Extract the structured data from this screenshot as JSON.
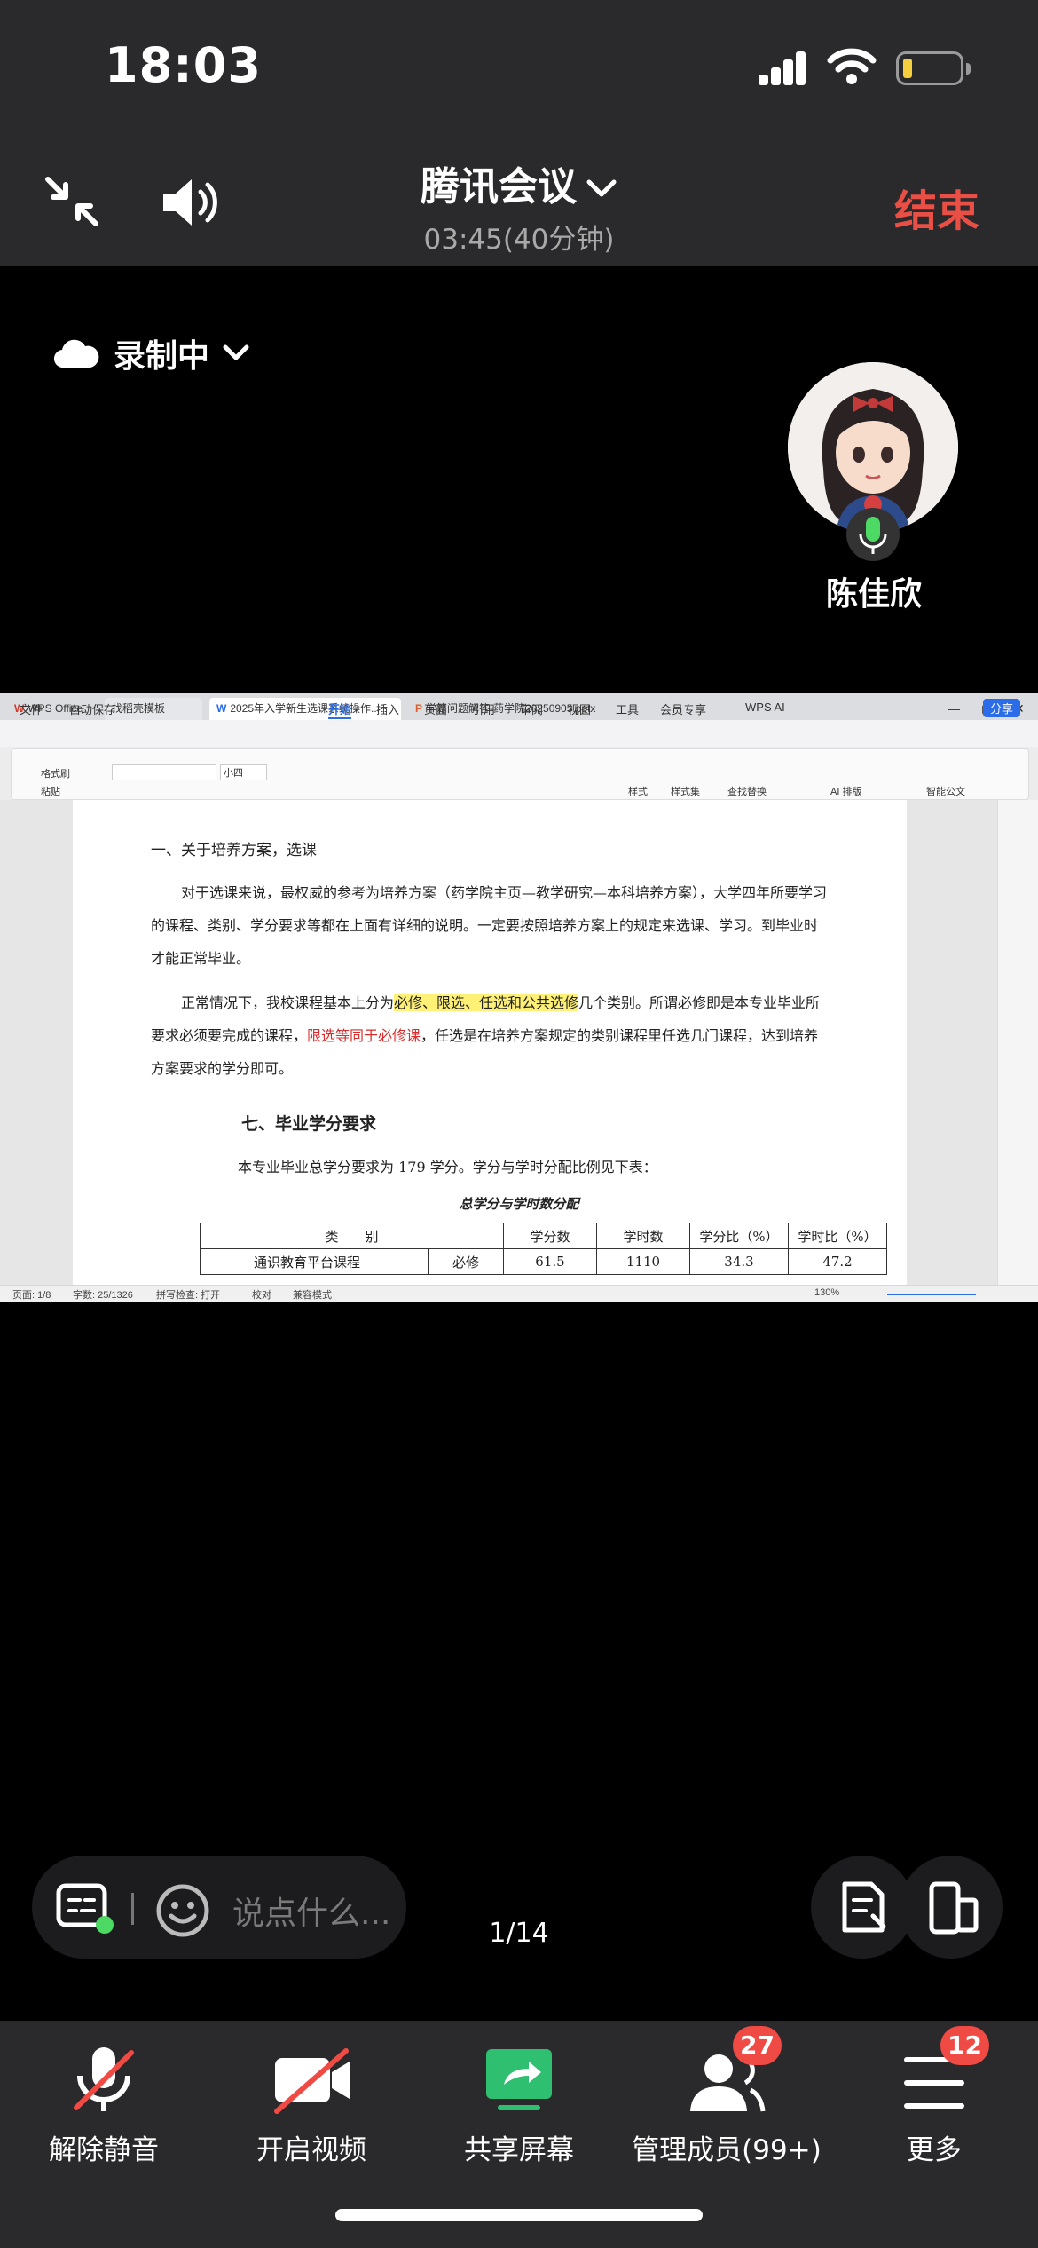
{
  "status_bar": {
    "time": "18:03"
  },
  "meeting": {
    "title": "腾讯会议",
    "timer": "03:45(40分钟)",
    "end_label": "结束"
  },
  "recording": {
    "label": "录制中"
  },
  "participant": {
    "name": "陈佳欣"
  },
  "shared_screen": {
    "tabs": [
      "WPS Office",
      "找稻壳模板",
      "2025年入学新生选课系统操作...",
      "学籍问题解答-药学院20250905.pptx"
    ],
    "menus": [
      "文件",
      "自动保存",
      "开始",
      "插入",
      "页面",
      "引用",
      "审阅",
      "视图",
      "工具",
      "会员专享",
      "WPS AI"
    ],
    "share_btn": "分享",
    "ribbon": {
      "format_painter": "格式刷",
      "paste": "粘贴",
      "font_size": "小四",
      "styles": "样式",
      "style_set": "样式集",
      "find_replace": "查找替换",
      "ai_layout": "AI 排版",
      "smart_doc": "智能公文"
    },
    "doc": {
      "heading1": "一、关于培养方案，选课",
      "para1": "对于选课来说，最权威的参考为培养方案（药学院主页—教学研究—本科培养方案），大学四年所要学习的课程、类别、学分要求等都在上面有详细的说明。一定要按照培养方案上的规定来选课、学习。到毕业时才能正常毕业。",
      "para2_a": "正常情况下，我校课程基本上分为",
      "para2_hl": "必修、限选、任选和公共选修",
      "para2_b": "几个类别。所谓必修即是本专业毕业所要求必须要完成的课程，",
      "para2_red": "限选等同于必修课",
      "para2_c": "，任选是在培养方案规定的类别课程里任选几门课程，达到培养方案要求的学分即可。",
      "heading2": "七、毕业学分要求",
      "para3": "本专业毕业总学分要求为 179 学分。学分与学时分配比例见下表：",
      "table_title": "总学分与学时数分配",
      "table_headers": [
        "类　　别",
        "学分数",
        "学时数",
        "学分比（%）",
        "学时比（%）"
      ],
      "table_row": [
        "通识教育平台课程",
        "必修",
        "61.5",
        "1110",
        "34.3",
        "47.2"
      ]
    },
    "status": {
      "page": "页面: 1/8",
      "words": "字数: 25/1326",
      "spell": "拼写检查: 打开",
      "proof": "校对",
      "compat": "兼容模式",
      "zoom": "130%"
    }
  },
  "chat": {
    "placeholder": "说点什么..."
  },
  "page_indicator": "1/14",
  "toolbar": {
    "unmute": "解除静音",
    "video": "开启视频",
    "share": "共享屏幕",
    "members": "管理成员(99+)",
    "members_badge": "27",
    "more": "更多",
    "more_badge": "12"
  },
  "colors": {
    "end_red": "#ea4f45",
    "badge_red": "#f04a44",
    "share_green": "#2fbf71",
    "battery_yellow": "#f4d03f"
  }
}
